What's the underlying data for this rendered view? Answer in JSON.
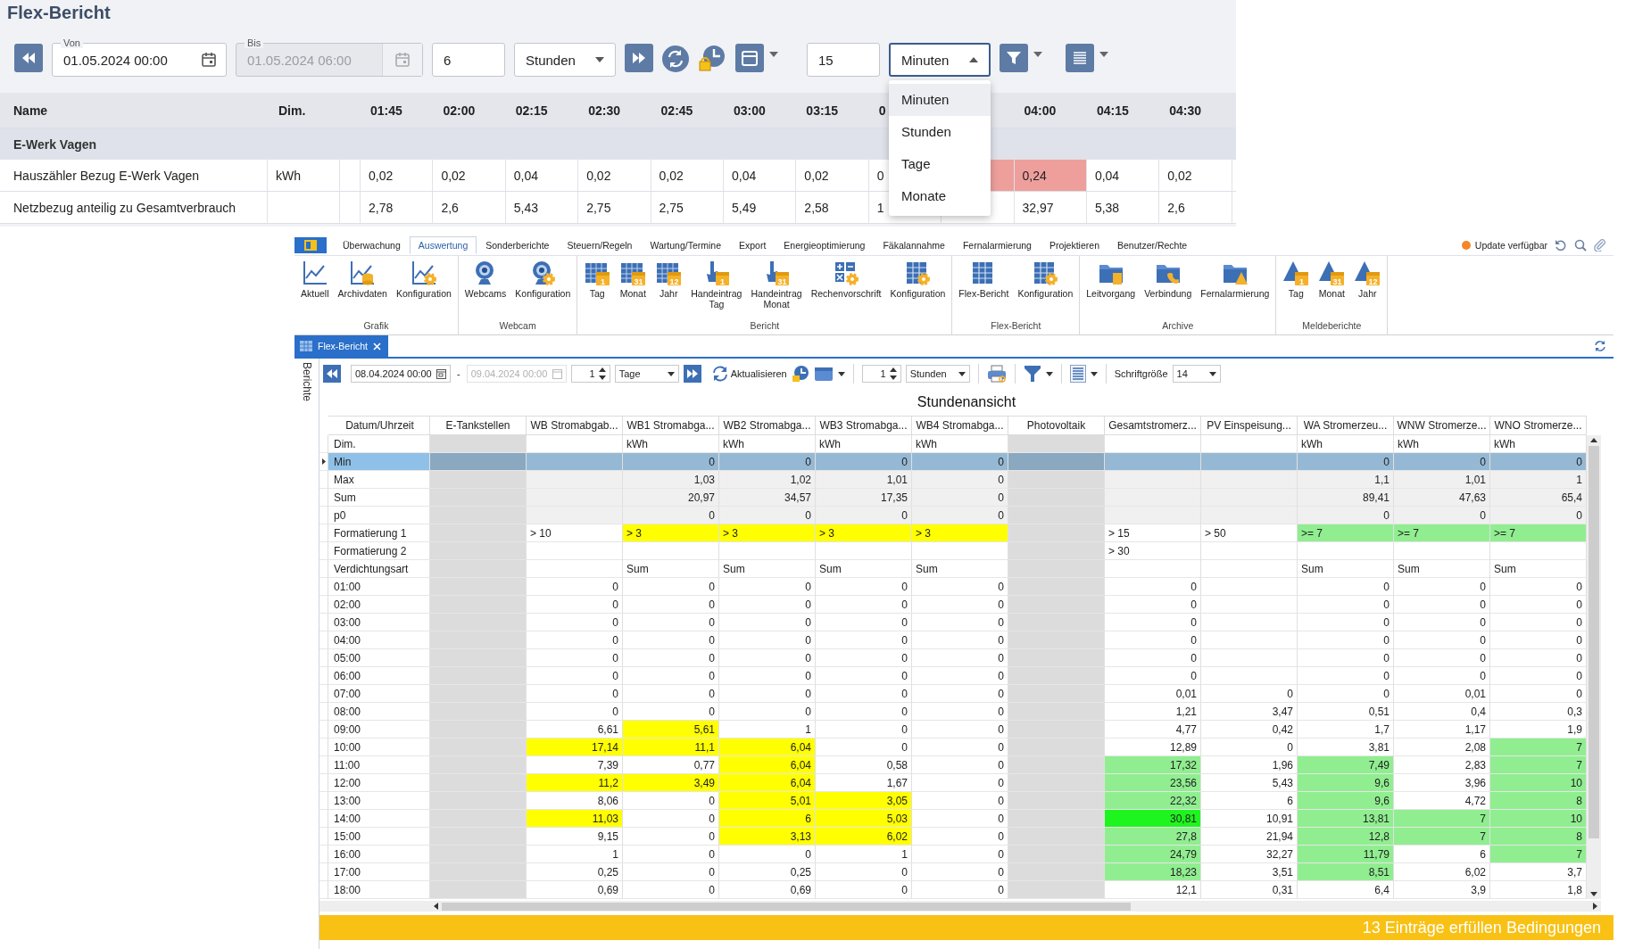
{
  "report": {
    "title": "Flex-Bericht",
    "toolbar": {
      "from": {
        "label": "Von",
        "value": "01.05.2024 00:00"
      },
      "to": {
        "label": "Bis",
        "value": "01.05.2024 06:00",
        "disabled": true
      },
      "range_count": "6",
      "range_unit": "Stunden",
      "step_count": "15",
      "step_unit": {
        "value": "Minuten",
        "expanded": true
      },
      "unit_menu": [
        {
          "label": "Minuten",
          "selected": true
        },
        {
          "label": "Stunden",
          "selected": false
        },
        {
          "label": "Tage",
          "selected": false
        },
        {
          "label": "Monate",
          "selected": false
        }
      ]
    },
    "table": {
      "columns": [
        "Name",
        "Dim."
      ],
      "times": [
        {
          "label": "01:45"
        },
        {
          "label": "02:00"
        },
        {
          "label": "02:15"
        },
        {
          "label": "02:30"
        },
        {
          "label": "02:45"
        },
        {
          "label": "03:00"
        },
        {
          "label": "03:15"
        },
        {
          "label": "0"
        },
        {
          "label": "04:00"
        },
        {
          "label": "04:15"
        },
        {
          "label": "04:30"
        }
      ],
      "group": "E-Werk Vagen",
      "rows": [
        {
          "name": "Hauszähler Bezug E-Werk Vagen",
          "dim": "kWh",
          "cells": [
            {
              "text": "0,02",
              "alert": false
            },
            {
              "text": "0,02",
              "alert": false
            },
            {
              "text": "0,04",
              "alert": false
            },
            {
              "text": "0,02",
              "alert": false
            },
            {
              "text": "0,02",
              "alert": false
            },
            {
              "text": "0,04",
              "alert": false
            },
            {
              "text": "0,02",
              "alert": false
            },
            {
              "text": "0",
              "alert": false
            },
            {
              "alert": true
            },
            {
              "text": "0,24",
              "alert": true
            },
            {
              "text": "0,04",
              "alert": false
            },
            {
              "text": "0,02",
              "alert": false
            }
          ]
        },
        {
          "name": "Netzbezug anteilig zu Gesamtverbrauch",
          "cells": [
            {
              "text": "2,78",
              "alert": false
            },
            {
              "text": "2,6",
              "alert": false
            },
            {
              "text": "5,43",
              "alert": false
            },
            {
              "text": "2,75",
              "alert": false
            },
            {
              "text": "2,75",
              "alert": false
            },
            {
              "text": "5,49",
              "alert": false
            },
            {
              "text": "2,58",
              "alert": false
            },
            {
              "text": "1",
              "alert": false
            },
            {
              "alert": false
            },
            {
              "text": "32,97",
              "alert": false
            },
            {
              "text": "5,38",
              "alert": false
            },
            {
              "text": "2,6",
              "alert": false
            }
          ]
        }
      ]
    }
  },
  "app": {
    "ribbon_tabs": [
      {
        "label": "Überwachung",
        "selected": false
      },
      {
        "label": "Auswertung",
        "selected": true
      },
      {
        "label": "Sonderberichte",
        "selected": false
      },
      {
        "label": "Steuern/Regeln",
        "selected": false
      },
      {
        "label": "Wartung/Termine",
        "selected": false
      },
      {
        "label": "Export",
        "selected": false
      },
      {
        "label": "Energieoptimierung",
        "selected": false
      },
      {
        "label": "Fäkalannahme",
        "selected": false
      },
      {
        "label": "Fernalarmierung",
        "selected": false
      },
      {
        "label": "Projektieren",
        "selected": false
      },
      {
        "label": "Benutzer/Rechte",
        "selected": false
      }
    ],
    "update_notice": "Update verfügbar",
    "ribbon_groups": [
      {
        "label": "Grafik",
        "items": [
          {
            "label": "Aktuell",
            "kind": "chart"
          },
          {
            "label": "Archivdaten",
            "kind": "archive"
          },
          {
            "label": "Konfiguration",
            "kind": "chartcfg"
          }
        ]
      },
      {
        "label": "Webcam",
        "items": [
          {
            "label": "Webcams",
            "kind": "webcam"
          },
          {
            "label": "Konfiguration",
            "kind": "webcamcfg"
          }
        ]
      },
      {
        "label": "Bericht",
        "items": [
          {
            "label": "Tag",
            "kind": "calendar",
            "badge": "1"
          },
          {
            "label": "Monat",
            "kind": "calendar",
            "badge": "31"
          },
          {
            "label": "Jahr",
            "kind": "calendar",
            "badge": "12"
          },
          {
            "label": "Handeintrag\nTag",
            "kind": "hand",
            "badge": "1"
          },
          {
            "label": "Handeintrag\nMonat",
            "kind": "hand",
            "badge": "31"
          },
          {
            "label": "Rechenvorschrift",
            "kind": "calc"
          },
          {
            "label": "Konfiguration",
            "kind": "gridcfg"
          }
        ]
      },
      {
        "label": "Flex-Bericht",
        "items": [
          {
            "label": "Flex-Bericht",
            "kind": "grid"
          },
          {
            "label": "Konfiguration",
            "kind": "gridcfg"
          }
        ]
      },
      {
        "label": "Archive",
        "items": [
          {
            "label": "Leitvorgang",
            "kind": "folder"
          },
          {
            "label": "Verbindung",
            "kind": "folderphone"
          },
          {
            "label": "Fernalarmierung",
            "kind": "folderwarn"
          }
        ]
      },
      {
        "label": "Meldeberichte",
        "items": [
          {
            "label": "Tag",
            "kind": "warncal",
            "badge": "1"
          },
          {
            "label": "Monat",
            "kind": "warncal",
            "badge": "31"
          },
          {
            "label": "Jahr",
            "kind": "warncal",
            "badge": "12"
          }
        ]
      }
    ],
    "document_tab": {
      "label": "Flex-Bericht",
      "selected": true
    },
    "side_tab": "Berichte",
    "toolbar": {
      "from": "08.04.2024 00:00",
      "separator": "-",
      "to": {
        "value": "09.04.2024 00:00",
        "disabled": true
      },
      "range_count": "1",
      "range_unit": "Tage",
      "refresh": "Aktualisieren",
      "step_count": "1",
      "step_unit": "Stunden",
      "font_size_label": "Schriftgröße",
      "font_size": "14"
    },
    "view_title": "Stundenansicht",
    "grid": {
      "label_column": "Datum/Uhrzeit",
      "columns": [
        {
          "label": "E-Tankstellen",
          "kind": "group"
        },
        {
          "label": "WB Stromabgab...",
          "kind": "value"
        },
        {
          "label": "WB1 Stromabga...",
          "kind": "value"
        },
        {
          "label": "WB2 Stromabga...",
          "kind": "value"
        },
        {
          "label": "WB3 Stromabga...",
          "kind": "value"
        },
        {
          "label": "WB4 Stromabga...",
          "kind": "value"
        },
        {
          "label": "Photovoltaik",
          "kind": "group"
        },
        {
          "label": "Gesamtstromerz...",
          "kind": "value"
        },
        {
          "label": "PV Einspeisung...",
          "kind": "value"
        },
        {
          "label": "WA Stromerzeu...",
          "kind": "value"
        },
        {
          "label": "WNW Stromerze...",
          "kind": "value"
        },
        {
          "label": "WNO Stromerze...",
          "kind": "value"
        }
      ],
      "rows": [
        {
          "label": "Dim.",
          "kind": "unit",
          "selected": false,
          "cells": [
            null,
            null,
            "kWh",
            "kWh",
            "kWh",
            "kWh",
            null,
            null,
            null,
            "kWh",
            "kWh",
            "kWh"
          ]
        },
        {
          "label": "Min",
          "kind": "summary",
          "selected": true,
          "cells": [
            null,
            null,
            "0",
            "0",
            "0",
            "0",
            null,
            null,
            null,
            "0",
            "0",
            "0"
          ]
        },
        {
          "label": "Max",
          "kind": "summary",
          "selected": false,
          "cells": [
            null,
            null,
            "1,03",
            "1,02",
            "1,01",
            "0",
            null,
            null,
            null,
            "1,1",
            "1,01",
            "1"
          ]
        },
        {
          "label": "Sum",
          "kind": "summary",
          "selected": false,
          "cells": [
            null,
            null,
            "20,97",
            "34,57",
            "17,35",
            "0",
            null,
            null,
            null,
            "89,41",
            "47,63",
            "65,4"
          ]
        },
        {
          "label": "p0",
          "kind": "summary",
          "selected": false,
          "cells": [
            null,
            null,
            "0",
            "0",
            "0",
            "0",
            null,
            null,
            null,
            "0",
            "0",
            "0"
          ]
        },
        {
          "label": "Formatierung 1",
          "kind": "setting",
          "selected": false,
          "cells": [
            null,
            "> 10",
            {
              "text": "> 3",
              "color": "#ffff00"
            },
            {
              "text": "> 3",
              "color": "#ffff00"
            },
            {
              "text": "> 3",
              "color": "#ffff00"
            },
            {
              "text": "> 3",
              "color": "#ffff00"
            },
            null,
            "> 15",
            "> 50",
            {
              "text": ">= 7",
              "color": "#90ee90"
            },
            {
              "text": ">= 7",
              "color": "#90ee90"
            },
            {
              "text": ">= 7",
              "color": "#90ee90"
            }
          ]
        },
        {
          "label": "Formatierung 2",
          "kind": "setting",
          "selected": false,
          "cells": [
            null,
            null,
            null,
            null,
            null,
            null,
            null,
            "> 30",
            null,
            null,
            null,
            null
          ]
        },
        {
          "label": "Verdichtungsart",
          "kind": "setting",
          "selected": false,
          "cells": [
            null,
            null,
            "Sum",
            "Sum",
            "Sum",
            "Sum",
            null,
            null,
            null,
            "Sum",
            "Sum",
            "Sum"
          ]
        },
        {
          "label": "01:00",
          "kind": "data",
          "selected": false,
          "cells": [
            null,
            "0",
            "0",
            "0",
            "0",
            "0",
            null,
            "0",
            null,
            "0",
            "0",
            "0"
          ]
        },
        {
          "label": "02:00",
          "kind": "data",
          "selected": false,
          "cells": [
            null,
            "0",
            "0",
            "0",
            "0",
            "0",
            null,
            "0",
            null,
            "0",
            "0",
            "0"
          ]
        },
        {
          "label": "03:00",
          "kind": "data",
          "selected": false,
          "cells": [
            null,
            "0",
            "0",
            "0",
            "0",
            "0",
            null,
            "0",
            null,
            "0",
            "0",
            "0"
          ]
        },
        {
          "label": "04:00",
          "kind": "data",
          "selected": false,
          "cells": [
            null,
            "0",
            "0",
            "0",
            "0",
            "0",
            null,
            "0",
            null,
            "0",
            "0",
            "0"
          ]
        },
        {
          "label": "05:00",
          "kind": "data",
          "selected": false,
          "cells": [
            null,
            "0",
            "0",
            "0",
            "0",
            "0",
            null,
            "0",
            null,
            "0",
            "0",
            "0"
          ]
        },
        {
          "label": "06:00",
          "kind": "data",
          "selected": false,
          "cells": [
            null,
            "0",
            "0",
            "0",
            "0",
            "0",
            null,
            "0",
            null,
            "0",
            "0",
            "0"
          ]
        },
        {
          "label": "07:00",
          "kind": "data",
          "selected": false,
          "cells": [
            null,
            "0",
            "0",
            "0",
            "0",
            "0",
            null,
            "0,01",
            "0",
            "0",
            "0,01",
            "0"
          ]
        },
        {
          "label": "08:00",
          "kind": "data",
          "selected": false,
          "cells": [
            null,
            "0",
            "0",
            "0",
            "0",
            "0",
            null,
            "1,21",
            "3,47",
            "0,51",
            "0,4",
            "0,3"
          ]
        },
        {
          "label": "09:00",
          "kind": "data",
          "selected": false,
          "cells": [
            null,
            "6,61",
            {
              "text": "5,61",
              "color": "#ffff00"
            },
            "1",
            "0",
            "0",
            null,
            "4,77",
            "0,42",
            "1,7",
            "1,17",
            "1,9"
          ]
        },
        {
          "label": "10:00",
          "kind": "data",
          "selected": false,
          "cells": [
            null,
            {
              "text": "17,14",
              "color": "#ffff00"
            },
            {
              "text": "11,1",
              "color": "#ffff00"
            },
            {
              "text": "6,04",
              "color": "#ffff00"
            },
            "0",
            "0",
            null,
            "12,89",
            "0",
            "3,81",
            "2,08",
            {
              "text": "7",
              "color": "#90ee90"
            }
          ]
        },
        {
          "label": "11:00",
          "kind": "data",
          "selected": false,
          "cells": [
            null,
            "7,39",
            "0,77",
            {
              "text": "6,04",
              "color": "#ffff00"
            },
            "0,58",
            "0",
            null,
            {
              "text": "17,32",
              "color": "#90ee90"
            },
            "1,96",
            {
              "text": "7,49",
              "color": "#90ee90"
            },
            "2,83",
            {
              "text": "7",
              "color": "#90ee90"
            }
          ]
        },
        {
          "label": "12:00",
          "kind": "data",
          "selected": false,
          "cells": [
            null,
            {
              "text": "11,2",
              "color": "#ffff00"
            },
            {
              "text": "3,49",
              "color": "#ffff00"
            },
            {
              "text": "6,04",
              "color": "#ffff00"
            },
            "1,67",
            "0",
            null,
            {
              "text": "23,56",
              "color": "#90ee90"
            },
            "5,43",
            {
              "text": "9,6",
              "color": "#90ee90"
            },
            "3,96",
            {
              "text": "10",
              "color": "#90ee90"
            }
          ]
        },
        {
          "label": "13:00",
          "kind": "data",
          "selected": false,
          "cells": [
            null,
            "8,06",
            "0",
            {
              "text": "5,01",
              "color": "#ffff00"
            },
            {
              "text": "3,05",
              "color": "#ffff00"
            },
            "0",
            null,
            {
              "text": "22,32",
              "color": "#90ee90"
            },
            "6",
            {
              "text": "9,6",
              "color": "#90ee90"
            },
            "4,72",
            {
              "text": "8",
              "color": "#90ee90"
            }
          ]
        },
        {
          "label": "14:00",
          "kind": "data",
          "selected": false,
          "cells": [
            null,
            {
              "text": "11,03",
              "color": "#ffff00"
            },
            "0",
            {
              "text": "6",
              "color": "#ffff00"
            },
            {
              "text": "5,03",
              "color": "#ffff00"
            },
            "0",
            null,
            {
              "text": "30,81",
              "color": "#1ef51e"
            },
            "10,91",
            {
              "text": "13,81",
              "color": "#90ee90"
            },
            {
              "text": "7",
              "color": "#90ee90"
            },
            {
              "text": "10",
              "color": "#90ee90"
            }
          ]
        },
        {
          "label": "15:00",
          "kind": "data",
          "selected": false,
          "cells": [
            null,
            "9,15",
            "0",
            {
              "text": "3,13",
              "color": "#ffff00"
            },
            {
              "text": "6,02",
              "color": "#ffff00"
            },
            "0",
            null,
            {
              "text": "27,8",
              "color": "#90ee90"
            },
            "21,94",
            {
              "text": "12,8",
              "color": "#90ee90"
            },
            {
              "text": "7",
              "color": "#90ee90"
            },
            {
              "text": "8",
              "color": "#90ee90"
            }
          ]
        },
        {
          "label": "16:00",
          "kind": "data",
          "selected": false,
          "cells": [
            null,
            "1",
            "0",
            "0",
            "1",
            "0",
            null,
            {
              "text": "24,79",
              "color": "#90ee90"
            },
            "32,27",
            {
              "text": "11,79",
              "color": "#90ee90"
            },
            "6",
            {
              "text": "7",
              "color": "#90ee90"
            }
          ]
        },
        {
          "label": "17:00",
          "kind": "data",
          "selected": false,
          "cells": [
            null,
            "0,25",
            "0",
            "0,25",
            "0",
            "0",
            null,
            {
              "text": "18,23",
              "color": "#90ee90"
            },
            "3,51",
            {
              "text": "8,51",
              "color": "#90ee90"
            },
            "6,02",
            "3,7"
          ]
        },
        {
          "label": "18:00",
          "kind": "data",
          "selected": false,
          "cells": [
            null,
            "0,69",
            "0",
            "0,69",
            "0",
            "0",
            null,
            "12,1",
            "0,31",
            "6,4",
            "3,9",
            "1,8"
          ]
        }
      ]
    },
    "status_bar": "13 Einträge erfüllen Bedingungen"
  }
}
